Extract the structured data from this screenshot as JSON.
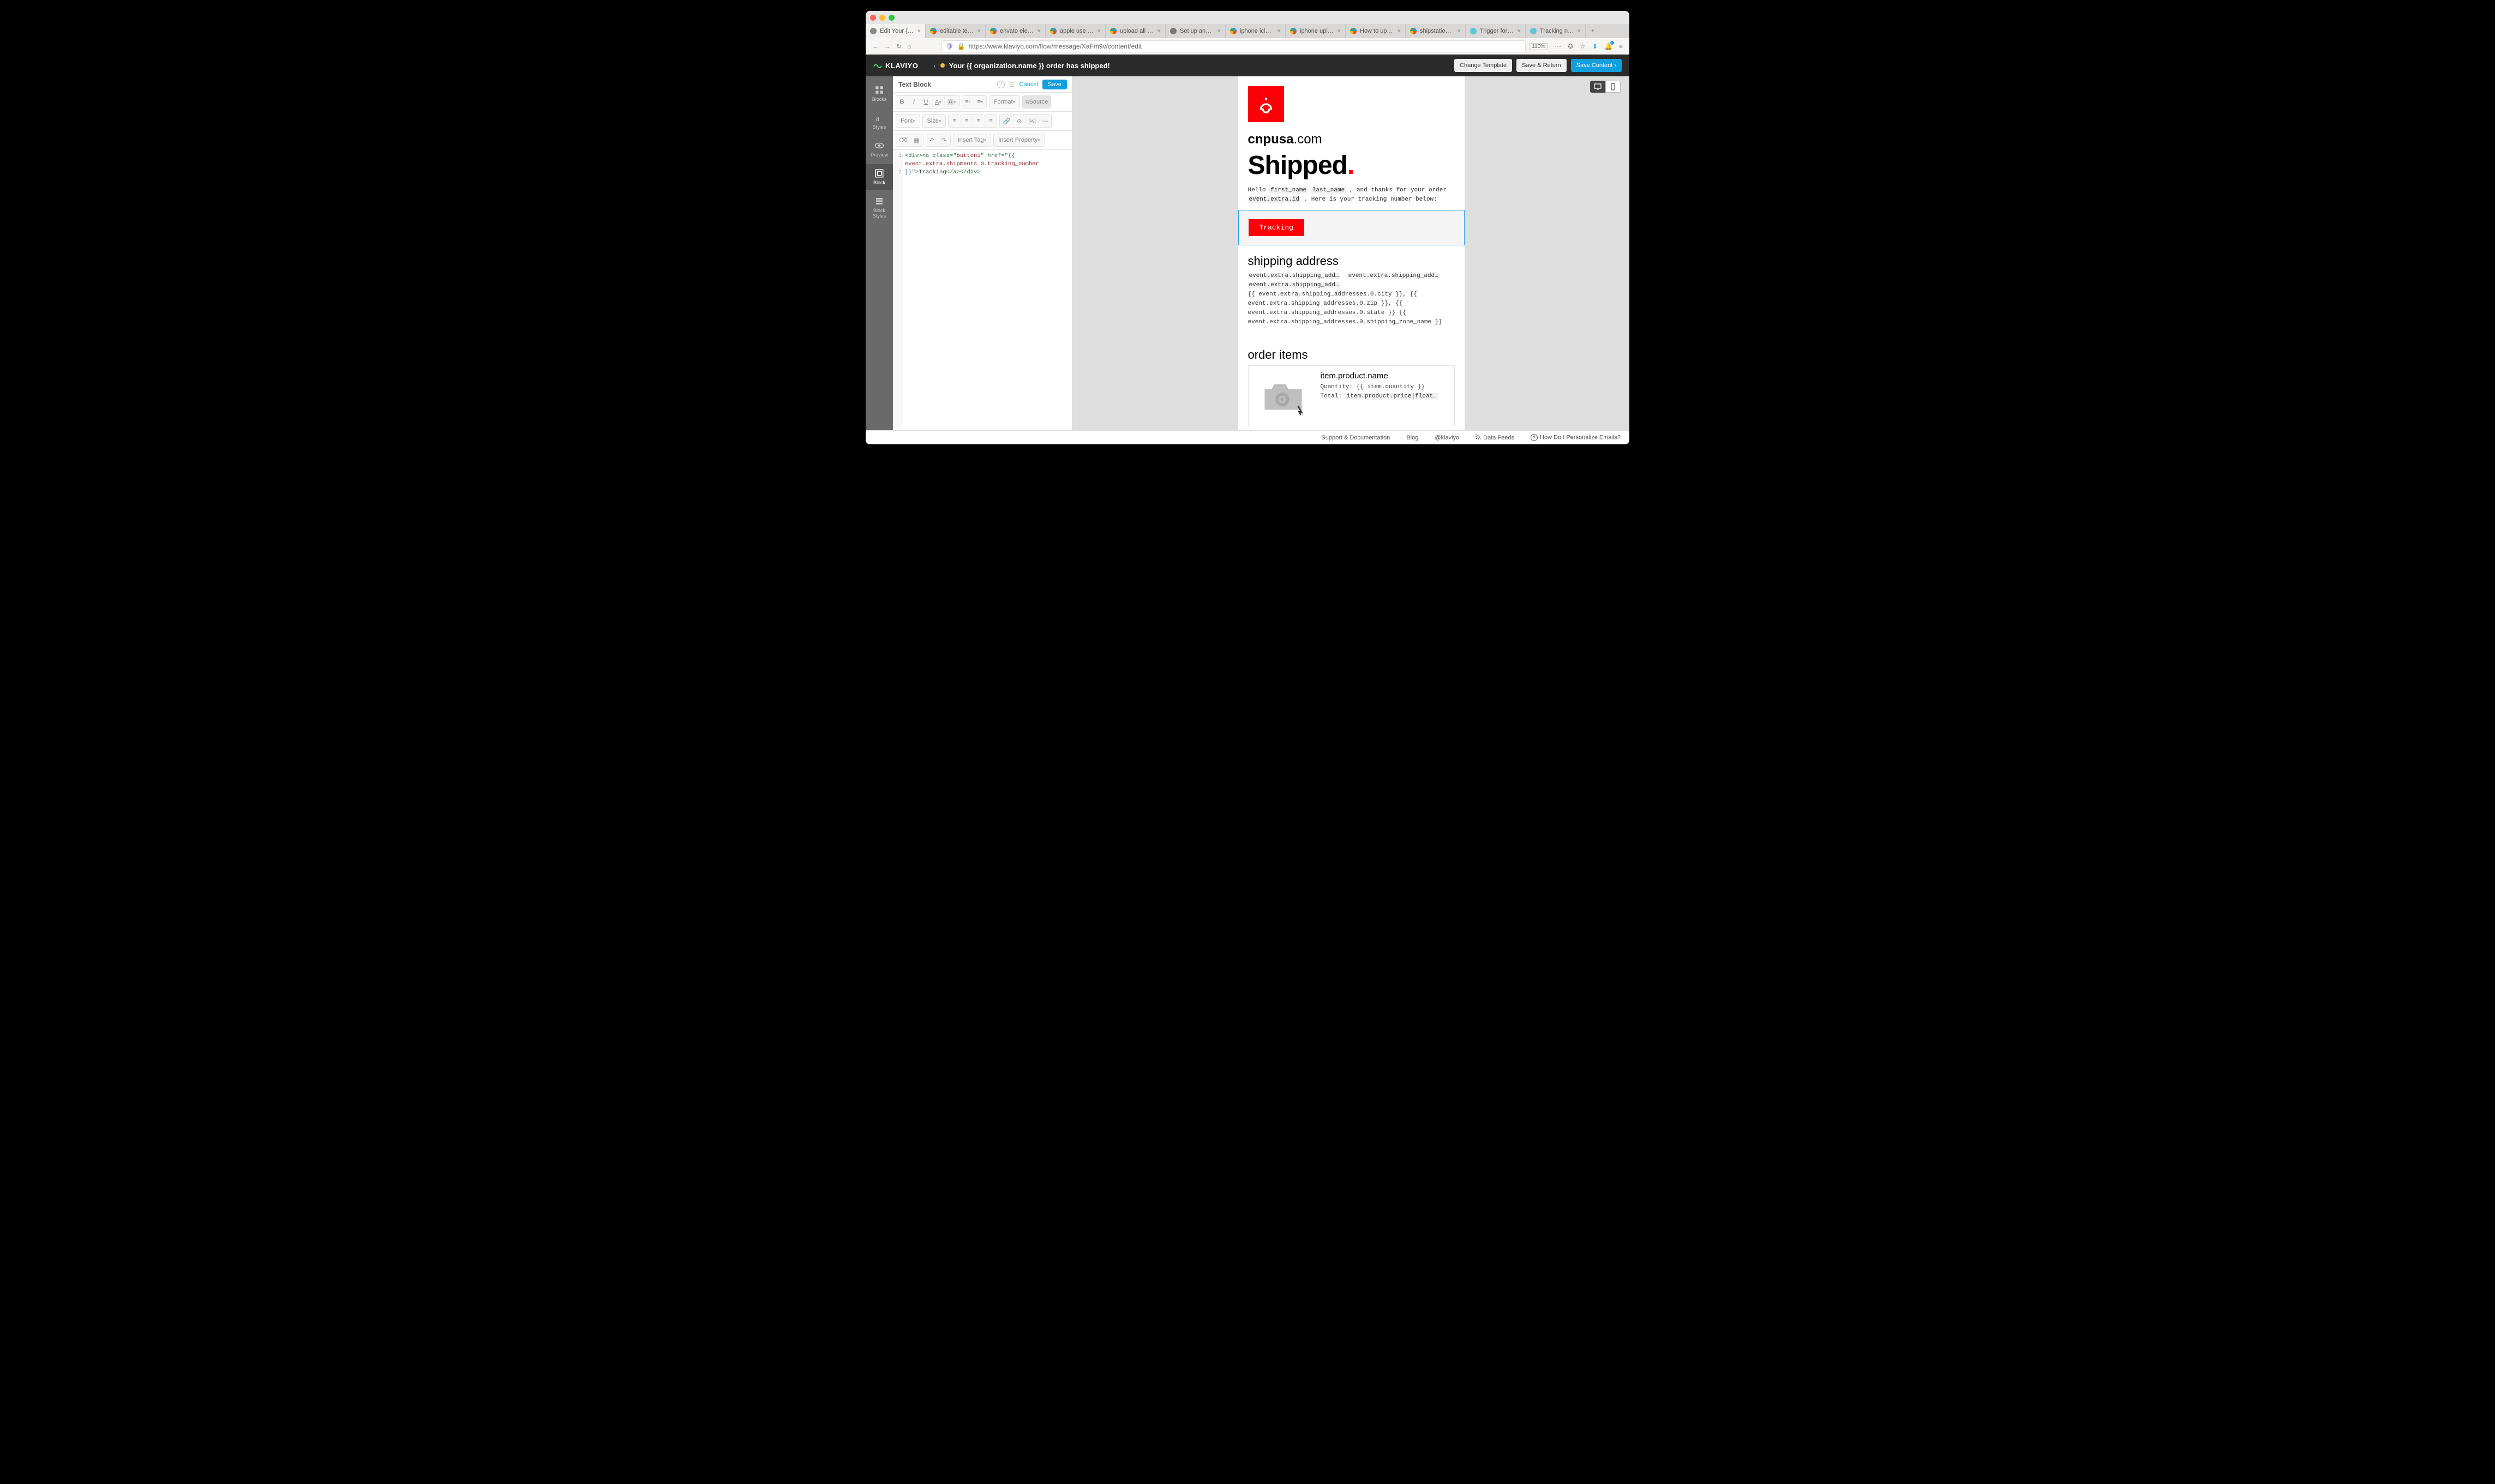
{
  "browser": {
    "tabs": [
      {
        "label": "Edit Your {{ organiza",
        "fav": "k"
      },
      {
        "label": "editable text effects",
        "fav": "g"
      },
      {
        "label": "envato element edit",
        "fav": "g"
      },
      {
        "label": "apple use cloud sto",
        "fav": "g"
      },
      {
        "label": "upload all iphone ph",
        "fav": "g"
      },
      {
        "label": "Set up and use iClo",
        "fav": "s"
      },
      {
        "label": "iphone icloud uploa",
        "fav": "g"
      },
      {
        "label": "iphone upload photo",
        "fav": "g"
      },
      {
        "label": "How to upload phot",
        "fav": "g"
      },
      {
        "label": "shipstation delivere",
        "fav": "g"
      },
      {
        "label": "Trigger for Package",
        "fav": "z"
      },
      {
        "label": "Tracking number fro",
        "fav": "z"
      }
    ],
    "url": "https://www.klaviyo.com/flow/message/XaFm9v/content/edit",
    "zoom": "110%"
  },
  "klaviyo": {
    "logo": "KLAVIYO",
    "subject": "Your {{ organization.name }} order has shipped!",
    "buttons": {
      "change": "Change Template",
      "savereturn": "Save & Return",
      "savecontent": "Save Content ›"
    }
  },
  "sidebar": {
    "items": [
      {
        "id": "blocks",
        "label": "Blocks"
      },
      {
        "id": "styles",
        "label": "Styles"
      },
      {
        "id": "preview",
        "label": "Preview"
      },
      {
        "id": "block",
        "label": "Block"
      },
      {
        "id": "blockstyles",
        "label": "Block\nStyles"
      }
    ],
    "active": "block"
  },
  "editor": {
    "title": "Text Block",
    "cancel": "Cancel",
    "save": "Save",
    "toolbar": {
      "format": "Format",
      "source": "Source",
      "font": "Font",
      "size": "Size",
      "inserttag": "Insert Tag",
      "insertprop": "Insert Property"
    },
    "code": {
      "line1_a": "<div><a class=\"",
      "line1_attr": "button1",
      "line1_b": "\" href=\"",
      "line1_c": "{{",
      "line1_d": "event.extra.shipments.0.tracking_number",
      "line1_e": "}}",
      "line1_f": "\">",
      "line1_txt": "Tracking",
      "line1_g": "</a></div>"
    }
  },
  "preview": {
    "brand_name_a": "cnpusa",
    "brand_name_b": ".com",
    "heading": "Shipped",
    "greet_a": "Hello ",
    "greet_fn": "first_name",
    "greet_ln": "last_name",
    "greet_b": " , and thanks for your order ",
    "greet_id": "event.extra.id",
    "greet_c": " . Here is your tracking number below:",
    "tracking_btn": "Tracking",
    "shipaddr_h": "shipping address",
    "addr_parts": [
      "event.extra.shipping_add…",
      "event.extra.shipping_add…",
      "event.extra.shipping_add…"
    ],
    "addr_free": "{{ event.extra.shipping_addresses.0.city }}, {{ event.extra.shipping_addresses.0.zip }}, {{ event.extra.shipping_addresses.0.state }} {{ event.extra.shipping_addresses.0.shipping_zone_name }}",
    "orderitems_h": "order items",
    "item_name": "item.product.name",
    "item_qty": "Quantity: {{ item.quantity }}",
    "item_total_a": "Total: ",
    "item_total_b": "item.product.price|float…"
  },
  "footer": {
    "support": "Support & Documentation",
    "blog": "Blog",
    "at": "@klaviyo",
    "feeds": "Data Feeds",
    "help": "How Do I Personalize Emails?"
  }
}
